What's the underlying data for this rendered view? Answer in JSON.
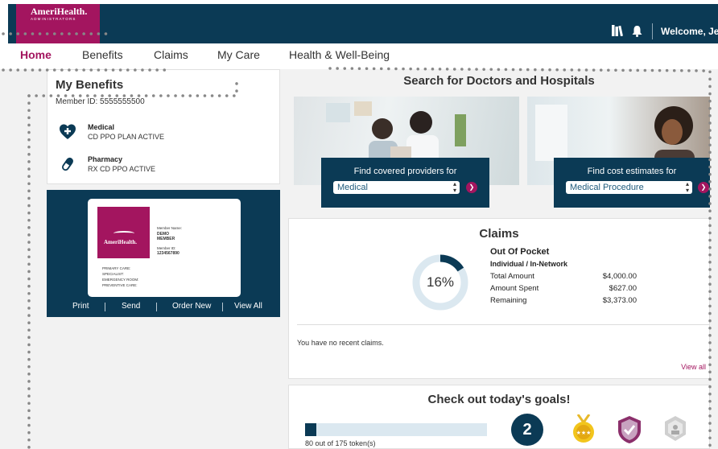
{
  "header": {
    "logo_brand": "AmeriHealth.",
    "logo_sub": "ADMINISTRATORS",
    "welcome": "Welcome, Je"
  },
  "nav": {
    "items": [
      "Home",
      "Benefits",
      "Claims",
      "My Care",
      "Health & Well-Being"
    ],
    "active": "Home"
  },
  "benefits": {
    "title": "My Benefits",
    "member_id": "Member ID: 5555555500",
    "plans": [
      {
        "name": "Medical",
        "status": "CD PPO PLAN ACTIVE",
        "icon": "heart-plus-icon"
      },
      {
        "name": "Pharmacy",
        "status": "RX CD PPO ACTIVE",
        "icon": "pill-icon"
      }
    ]
  },
  "id_card": {
    "brand": "AmeriHealth.",
    "member_name_label": "Member Name:",
    "member_first": "DEMO",
    "member_last": "MEMBER",
    "member_id_label": "Member ID:",
    "member_id_value": "1234567890",
    "coverage_lines": [
      "PRIMARY CARE:",
      "SPECIALIST:",
      "EMERGENCY ROOM:",
      "PREVENTIVE CARE:"
    ],
    "actions": [
      "Print",
      "Send",
      "Order New",
      "View All"
    ]
  },
  "search": {
    "title": "Search for Doctors and Hospitals",
    "providers": {
      "label": "Find covered providers for",
      "selected": "Medical"
    },
    "costs": {
      "label": "Find cost estimates for",
      "selected": "Medical Procedure"
    }
  },
  "claims": {
    "title": "Claims",
    "percent_label": "16%",
    "percent_value": 0.16,
    "oop_title": "Out Of Pocket",
    "oop_sub": "Individual / In-Network",
    "rows": [
      {
        "label": "Total Amount",
        "value": "$4,000.00"
      },
      {
        "label": "Amount Spent",
        "value": "$627.00"
      },
      {
        "label": "Remaining",
        "value": "$3,373.00"
      }
    ],
    "no_claims": "You have no recent claims.",
    "view_all": "View all"
  },
  "goals": {
    "title": "Check out today's goals!",
    "tokens_text": "80 out of 175 token(s)",
    "tokens_fraction": 0.06,
    "goal_count": "2"
  },
  "colors": {
    "navy": "#0b3a55",
    "magenta": "#a3155f",
    "light_blue": "#dbe8f0"
  }
}
